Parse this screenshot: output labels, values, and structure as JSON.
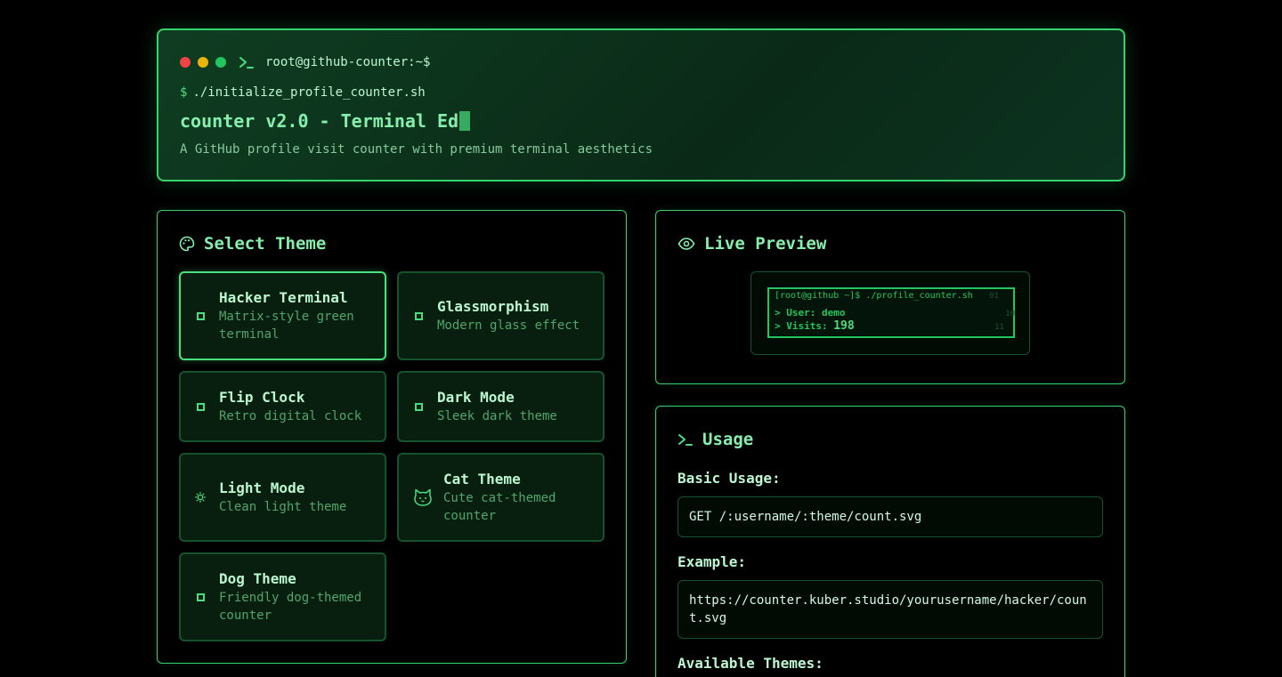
{
  "header": {
    "prompt": "root@github-counter:~$",
    "command_dollar": "$",
    "command": "./initialize_profile_counter.sh",
    "title": "counter v2.0 - Terminal Ed",
    "subtitle": "A GitHub profile visit counter with premium terminal aesthetics"
  },
  "theme_panel": {
    "heading": "Select Theme",
    "themes": [
      {
        "name": "Hacker Terminal",
        "desc": "Matrix-style green terminal",
        "icon": "square-icon",
        "selected": true
      },
      {
        "name": "Glassmorphism",
        "desc": "Modern glass effect",
        "icon": "square-icon"
      },
      {
        "name": "Flip Clock",
        "desc": "Retro digital clock",
        "icon": "square-icon"
      },
      {
        "name": "Dark Mode",
        "desc": "Sleek dark theme",
        "icon": "square-icon"
      },
      {
        "name": "Light Mode",
        "desc": "Clean light theme",
        "icon": "sun-icon"
      },
      {
        "name": "Cat Theme",
        "desc": "Cute cat-themed counter",
        "icon": "cat-icon"
      },
      {
        "name": "Dog Theme",
        "desc": "Friendly dog-themed counter",
        "icon": "square-icon"
      }
    ]
  },
  "preview_panel": {
    "heading": "Live Preview",
    "terminal": {
      "line1": "[root@github ~]$ ./profile_counter.sh",
      "user_label": "> User:",
      "user_value": "demo",
      "visits_label": "> Visits:",
      "visits_value": "198",
      "line_numbers": [
        "01",
        "10",
        "11"
      ]
    }
  },
  "usage_panel": {
    "heading": "Usage",
    "basic_label": "Basic Usage:",
    "basic_code": "GET /:username/:theme/count.svg",
    "example_label": "Example:",
    "example_code": "https://counter.kuber.studio/yourusername/hacker/count.svg",
    "available_label": "Available Themes:"
  },
  "colors": {
    "accent": "#4ade80",
    "border": "#34d36b",
    "dot_red": "#ef4444",
    "dot_yellow": "#eab308",
    "dot_green": "#22c55e"
  }
}
